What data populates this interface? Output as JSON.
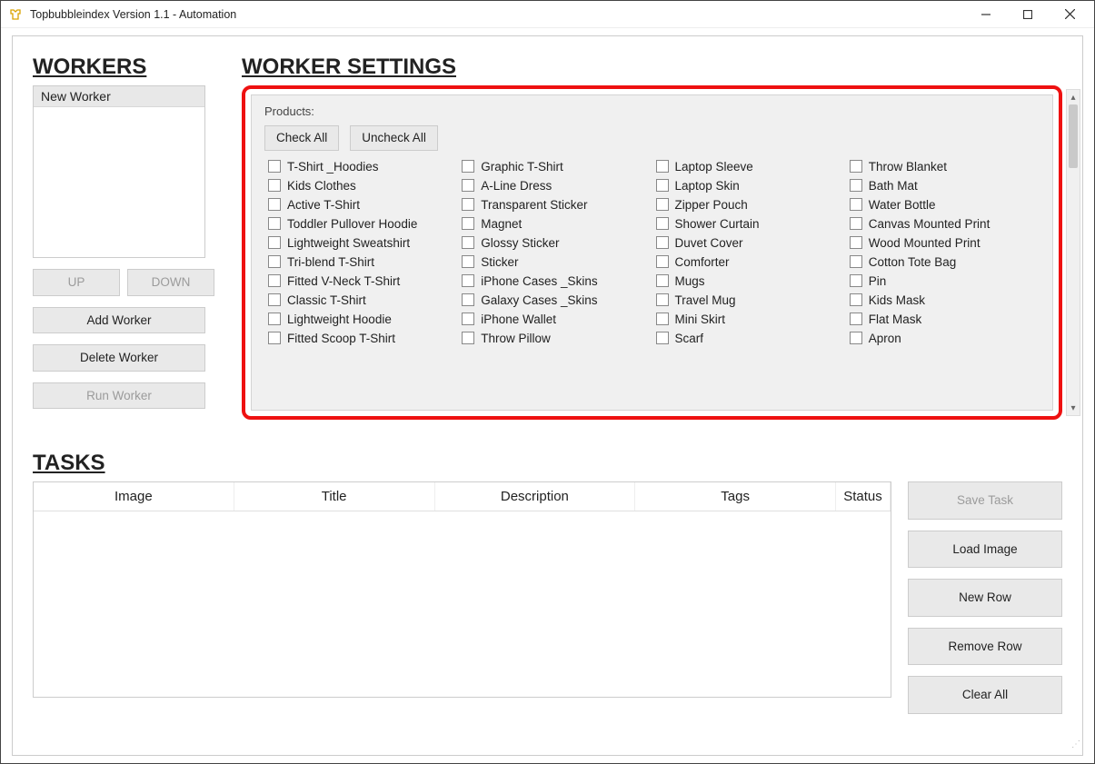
{
  "window": {
    "title": "Topbubbleindex Version 1.1 - Automation"
  },
  "workers": {
    "heading": "WORKERS",
    "list_item": "New Worker",
    "up": "UP",
    "down": "DOWN",
    "add": "Add Worker",
    "delete": "Delete Worker",
    "run": "Run Worker"
  },
  "settings": {
    "heading": "WORKER SETTINGS",
    "fieldset_label": "Products:",
    "check_all": "Check All",
    "uncheck_all": "Uncheck All",
    "products": [
      "T-Shirt _Hoodies",
      "Graphic T-Shirt",
      "Laptop Sleeve",
      "Throw Blanket",
      "Kids Clothes",
      "A-Line Dress",
      "Laptop Skin",
      "Bath Mat",
      "Active T-Shirt",
      "Transparent Sticker",
      "Zipper Pouch",
      "Water Bottle",
      "Toddler Pullover Hoodie",
      "Magnet",
      "Shower Curtain",
      "Canvas Mounted Print",
      "Lightweight Sweatshirt",
      "Glossy Sticker",
      "Duvet Cover",
      "Wood Mounted Print",
      "Tri-blend T-Shirt",
      "Sticker",
      "Comforter",
      "Cotton Tote Bag",
      "Fitted V-Neck T-Shirt",
      "iPhone Cases _Skins",
      "Mugs",
      "Pin",
      "Classic T-Shirt",
      "Galaxy Cases _Skins",
      "Travel Mug",
      "Kids Mask",
      "Lightweight Hoodie",
      "iPhone Wallet",
      "Mini Skirt",
      "Flat Mask",
      "Fitted Scoop T-Shirt",
      "Throw Pillow",
      "Scarf",
      "Apron"
    ]
  },
  "tasks": {
    "heading": "TASKS",
    "columns": {
      "image": "Image",
      "title": "Title",
      "description": "Description",
      "tags": "Tags",
      "status": "Status"
    },
    "buttons": {
      "save": "Save Task",
      "load": "Load Image",
      "newrow": "New Row",
      "remove": "Remove Row",
      "clear": "Clear All"
    }
  }
}
